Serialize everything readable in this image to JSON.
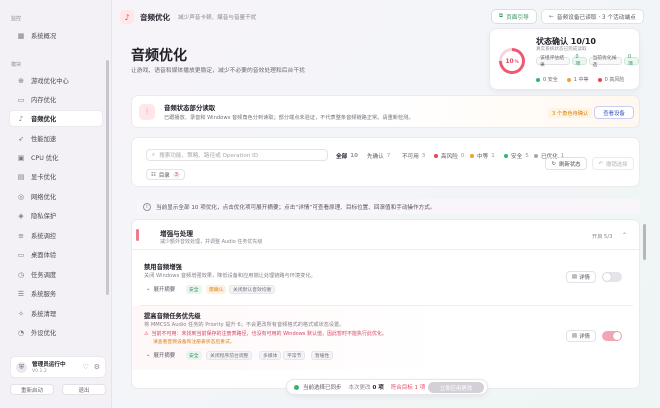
{
  "sidebar": {
    "group_monitor": "监控",
    "group_modules": "模块",
    "items": [
      {
        "label": "系统概况",
        "icon": "chart-icon"
      },
      {
        "label": "游戏优化中心",
        "icon": "gamepad-icon"
      },
      {
        "label": "内存优化",
        "icon": "memory-icon"
      },
      {
        "label": "音频优化",
        "icon": "audio-icon"
      },
      {
        "label": "性能加速",
        "icon": "rocket-icon"
      },
      {
        "label": "CPU 优化",
        "icon": "cpu-icon"
      },
      {
        "label": "显卡优化",
        "icon": "gpu-icon"
      },
      {
        "label": "网络优化",
        "icon": "network-icon"
      },
      {
        "label": "隐私保护",
        "icon": "privacy-icon"
      },
      {
        "label": "系统调控",
        "icon": "tune-icon"
      },
      {
        "label": "桌面体验",
        "icon": "desktop-icon"
      },
      {
        "label": "任务调度",
        "icon": "schedule-icon"
      },
      {
        "label": "系统服务",
        "icon": "services-icon"
      },
      {
        "label": "系统清理",
        "icon": "clean-icon"
      },
      {
        "label": "外设优化",
        "icon": "peripheral-icon"
      }
    ],
    "admin_title": "管理员运行中",
    "admin_version": "V0.1.2",
    "restart_label": "重新启动",
    "exit_label": "退出"
  },
  "topbar": {
    "title": "音频优化",
    "subtitle": "减少声音卡顿、爆音与音量干扰",
    "guide_label": "页面引导",
    "status_label": "音频设备已读取 · 3 个活动端点"
  },
  "hero": {
    "title": "音频优化",
    "subtitle": "让游戏、语音和媒体播放更稳定，减少不必要的音效处理和后台干扰"
  },
  "status_card": {
    "ring_value": "10",
    "ring_unit": "%",
    "title": "状态确认 10/10",
    "subtitle": "真实系统状态已完成读取",
    "tags": [
      "该组评估结果",
      "0项",
      "当前优化候选",
      "0项"
    ],
    "legend": [
      {
        "label": "0 安全",
        "color": "#36b36b"
      },
      {
        "label": "1 中等",
        "color": "#f0a030"
      },
      {
        "label": "0 高风险",
        "color": "#e5484d"
      }
    ]
  },
  "warn_card": {
    "title": "音频状态部分读取",
    "desc": "已跟播放、录音和 Windows 音频角色分到读取；部分端点未验证，不代表整条音频链路正常。请重新检测。",
    "badge": "3 个角色待确认",
    "action": "查看设备"
  },
  "search": {
    "placeholder": "搜索功能、策略、路径或 Operation ID",
    "filters": [
      {
        "label": "全部",
        "count": "10",
        "color": ""
      },
      {
        "label": "先确认",
        "count": "7",
        "color": ""
      },
      {
        "label": "不可用",
        "count": "3",
        "color": ""
      },
      {
        "label": "高风险",
        "count": "0",
        "color": "#e5484d"
      },
      {
        "label": "中等",
        "count": "1",
        "color": "#f0a030"
      },
      {
        "label": "安全",
        "count": "5",
        "color": "#36b36b"
      },
      {
        "label": "已优化",
        "count": "1",
        "color": "#a9a5af"
      }
    ],
    "refresh_label": "刷新状态",
    "undo_label": "撤销选择",
    "catalog_label": "目录",
    "catalog_count": "3"
  },
  "info_bar": {
    "text": "当前显示全部 10 项优化，点击优化项可展开摘要；点击“详情”可查看原理、目标位置、回滚值和手动操作方式。"
  },
  "section": {
    "title": "增强与处理",
    "subtitle": "减少额外音效处理，并调整 Audio 任务优先级",
    "count": "开启 5/3"
  },
  "items": [
    {
      "title": "禁用音频增强",
      "desc": "关闭 Windows 音频增强效果，降低设备和应用端让处理链路与环境变化。",
      "expand": "展开摘要",
      "tags": [
        "安全",
        "需确认",
        "关闭默认音效均衡"
      ],
      "detail": "详情"
    },
    {
      "title": "提高音频任务优先级",
      "desc": "将 MMCSS Audio 任务的 Priority 提升 6；不会更改所有音频格式的格式或状态设置。",
      "warn1": "当前不可用：未找到当前保存的注册表路径，也没有可用的 Windows 默认值，因此暂时不能执行此优化。",
      "warn2": "请查看音频设备和注册表状态后重试。",
      "expand": "展开摘要",
      "tags": [
        "安全",
        "关闭程序前台调整",
        "多媒体",
        "平常节",
        "暂缓性"
      ],
      "detail": "详情"
    }
  ],
  "bottom_bar": {
    "sync_label": "当前选择已同步",
    "changes_label": "本次更改",
    "changes_count": "0 项",
    "target_label": "符合目标 1 项",
    "apply_label": "立即应用更改"
  }
}
